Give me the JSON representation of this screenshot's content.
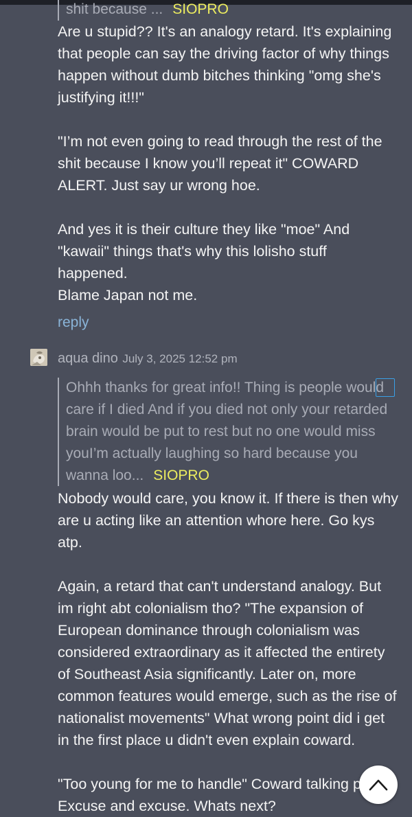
{
  "quote1": {
    "excerpt": "shit because ...",
    "author": "SIOPRO"
  },
  "comment1": {
    "lines": [
      "Are u stupid?? It's an analogy retard. It's explaining",
      "that people can say the driving factor of why things",
      "happen without dumb bitches thinking \"omg she's",
      "justifying it!!!\"",
      "",
      "\"I’m not even going to read through the rest of the",
      "shit because I know you’ll repeat it\" COWARD",
      "ALERT. Just say ur wrong hoe.",
      "",
      "And yes it is their culture they like \"moe\" And",
      "\"kawaii\" things that's why this lolisho stuff",
      "happened.",
      "Blame Japan not me."
    ],
    "reply_label": "reply"
  },
  "comment2": {
    "author": "aqua dino",
    "date": "July 3, 2025 12:52 pm",
    "quote": {
      "lines": [
        "Ohhh thanks for great info!! Thing is people would",
        "care if I died And if you died not only your retarded",
        "brain would be put to rest but no one would miss",
        "youI’m actually laughing so hard because you",
        "wanna loo..."
      ],
      "author": "SIOPRO"
    },
    "lines": [
      "Nobody would care, you know it. If there is then why",
      "are u acting like an attention whore here. Go kys",
      "atp.",
      "",
      "Again, a retard that can't understand analogy. But",
      "im right abt colonialism tho? \"The expansion of",
      "European dominance through colonialism was",
      "considered extraordinary as it affected the entirety",
      "of Southeast Asia significantly. Later on, more",
      "common features would emerge, such as the rise of",
      "nationalist movements\" What wrong point did i get",
      "in the first place u didn't even explain coward.",
      "",
      "\"Too young for me to handle\" Coward talking p",
      "Excuse and excuse. Whats next?"
    ]
  },
  "icons": {
    "scroll_top": "chevron-up-icon",
    "avatar": "avatar-image"
  },
  "colors": {
    "background": "#4a4e5b",
    "quote_author": "#ecec5f",
    "link": "#8ab4d8",
    "highlight": "#3aa0e6"
  }
}
